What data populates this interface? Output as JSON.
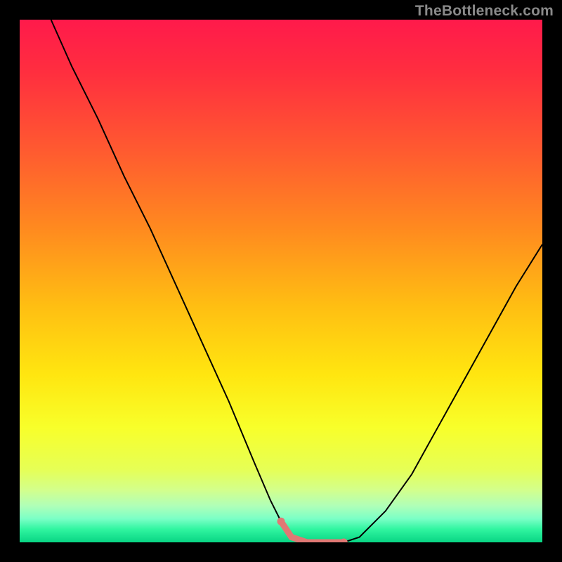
{
  "watermark": "TheBottleneck.com",
  "colors": {
    "black": "#000000",
    "curve": "#000000",
    "flat_highlight": "#e07874",
    "gradient_stops": [
      {
        "offset": 0.0,
        "color": "#ff1a4b"
      },
      {
        "offset": 0.1,
        "color": "#ff2e3f"
      },
      {
        "offset": 0.25,
        "color": "#ff5a30"
      },
      {
        "offset": 0.4,
        "color": "#ff8a1f"
      },
      {
        "offset": 0.55,
        "color": "#ffbf12"
      },
      {
        "offset": 0.68,
        "color": "#ffe610"
      },
      {
        "offset": 0.78,
        "color": "#f8ff2a"
      },
      {
        "offset": 0.86,
        "color": "#e6ff55"
      },
      {
        "offset": 0.9,
        "color": "#d3ff8c"
      },
      {
        "offset": 0.93,
        "color": "#b0ffb8"
      },
      {
        "offset": 0.955,
        "color": "#7affc6"
      },
      {
        "offset": 0.975,
        "color": "#30f5a0"
      },
      {
        "offset": 1.0,
        "color": "#08d584"
      }
    ]
  },
  "chart_data": {
    "type": "line",
    "title": "",
    "xlabel": "",
    "ylabel": "",
    "x_range": [
      0,
      100
    ],
    "y_range": [
      0,
      100
    ],
    "grid": false,
    "legend": false,
    "series": [
      {
        "name": "bottleneck-curve",
        "x": [
          6,
          10,
          15,
          20,
          25,
          30,
          35,
          40,
          45,
          48,
          50,
          52,
          55,
          57,
          60,
          62,
          65,
          70,
          75,
          80,
          85,
          90,
          95,
          100
        ],
        "y": [
          100,
          91,
          81,
          70,
          60,
          49,
          38,
          27,
          15,
          8,
          4,
          1,
          0,
          0,
          0,
          0,
          1,
          6,
          13,
          22,
          31,
          40,
          49,
          57
        ]
      }
    ],
    "flat_region_x": [
      50,
      63
    ],
    "annotations": []
  }
}
